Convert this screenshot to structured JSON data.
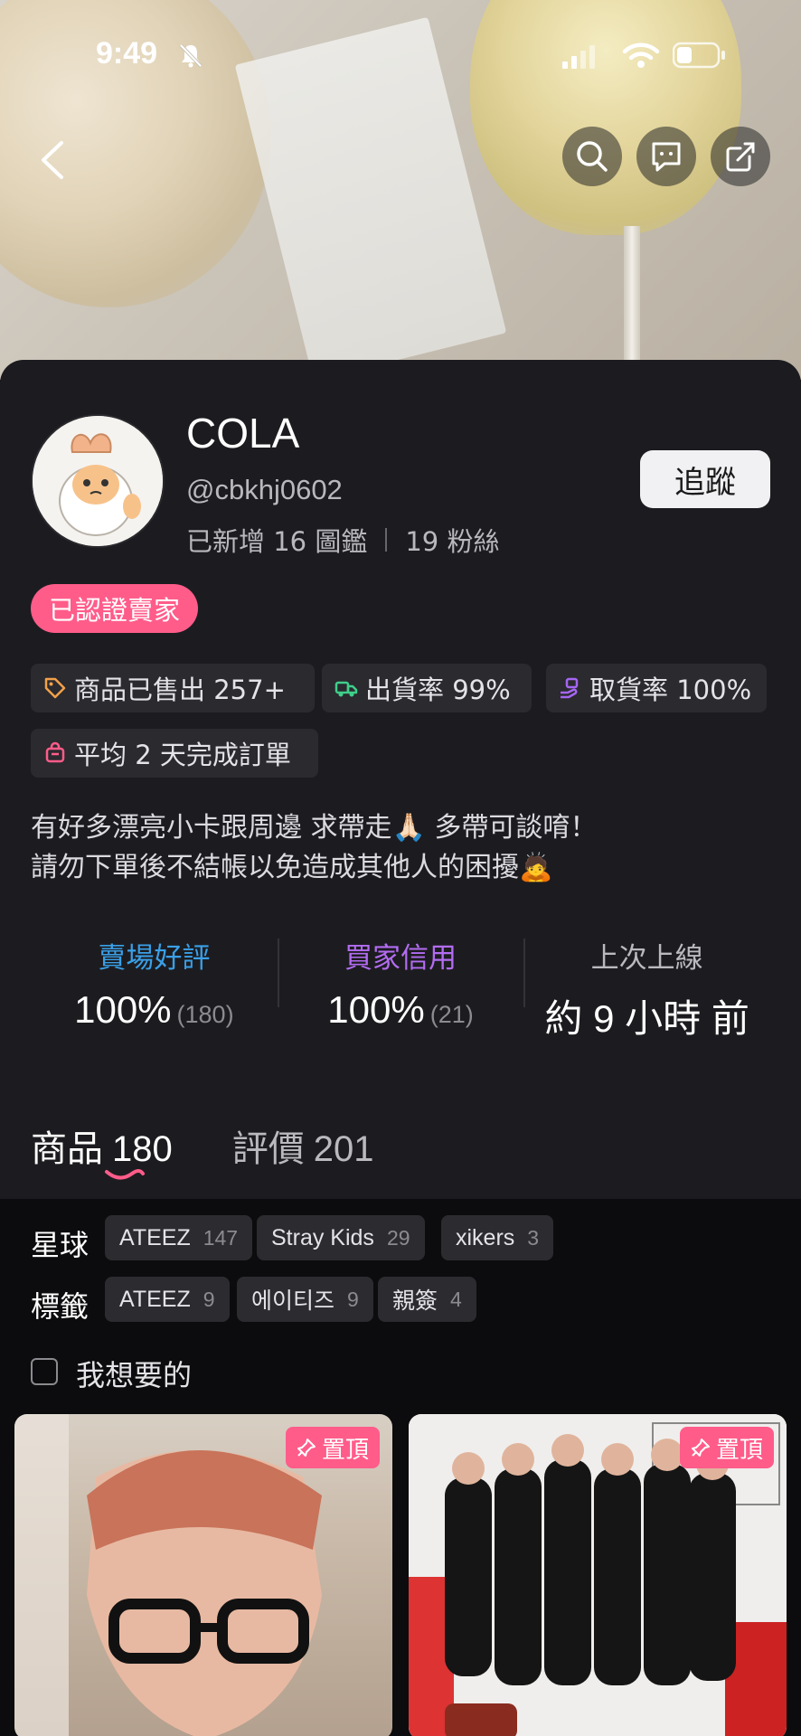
{
  "status_bar": {
    "time": "9:49"
  },
  "profile": {
    "name": "COLA",
    "handle": "@cbkhj0602",
    "collections": "已新增 16 圖鑑",
    "followers": "19 粉絲",
    "follow_label": "追蹤",
    "verified_badge": "已認證賣家"
  },
  "badges": {
    "sold": "商品已售出 257+",
    "ship_rate": "出貨率 99%",
    "pickup_rate": "取貨率 100%",
    "avg_days": "平均 2 天完成訂單"
  },
  "bio": {
    "line1": "有好多漂亮小卡跟周邊 求帶走🙏🏻 多帶可談唷！",
    "line2": "請勿下單後不結帳以免造成其他人的困擾🙇"
  },
  "ratings": {
    "store": {
      "title": "賣場好評",
      "value": "100%",
      "count": "(180)"
    },
    "buyer": {
      "title": "買家信用",
      "value": "100%",
      "count": "(21)"
    },
    "last_online": {
      "title": "上次上線",
      "value": "約 9 小時 前"
    }
  },
  "tabs": {
    "products_label": "商品",
    "products_count": "180",
    "reviews_label": "評價",
    "reviews_count": "201"
  },
  "filters": {
    "planet_label": "星球",
    "planets": [
      {
        "name": "ATEEZ",
        "count": "147"
      },
      {
        "name": "Stray Kids",
        "count": "29"
      },
      {
        "name": "xikers",
        "count": "3"
      }
    ],
    "tag_label": "標籤",
    "tags": [
      {
        "name": "ATEEZ",
        "count": "9"
      },
      {
        "name": "에이티즈",
        "count": "9"
      },
      {
        "name": "親簽",
        "count": "4"
      }
    ],
    "want_label": "我想要的"
  },
  "cards": {
    "pin_label": "置頂"
  },
  "colors": {
    "accent_pink": "#ff5c8a",
    "store_rating": "#3aa0e8",
    "buyer_rating": "#b36cf2",
    "background": "#1c1c20"
  }
}
